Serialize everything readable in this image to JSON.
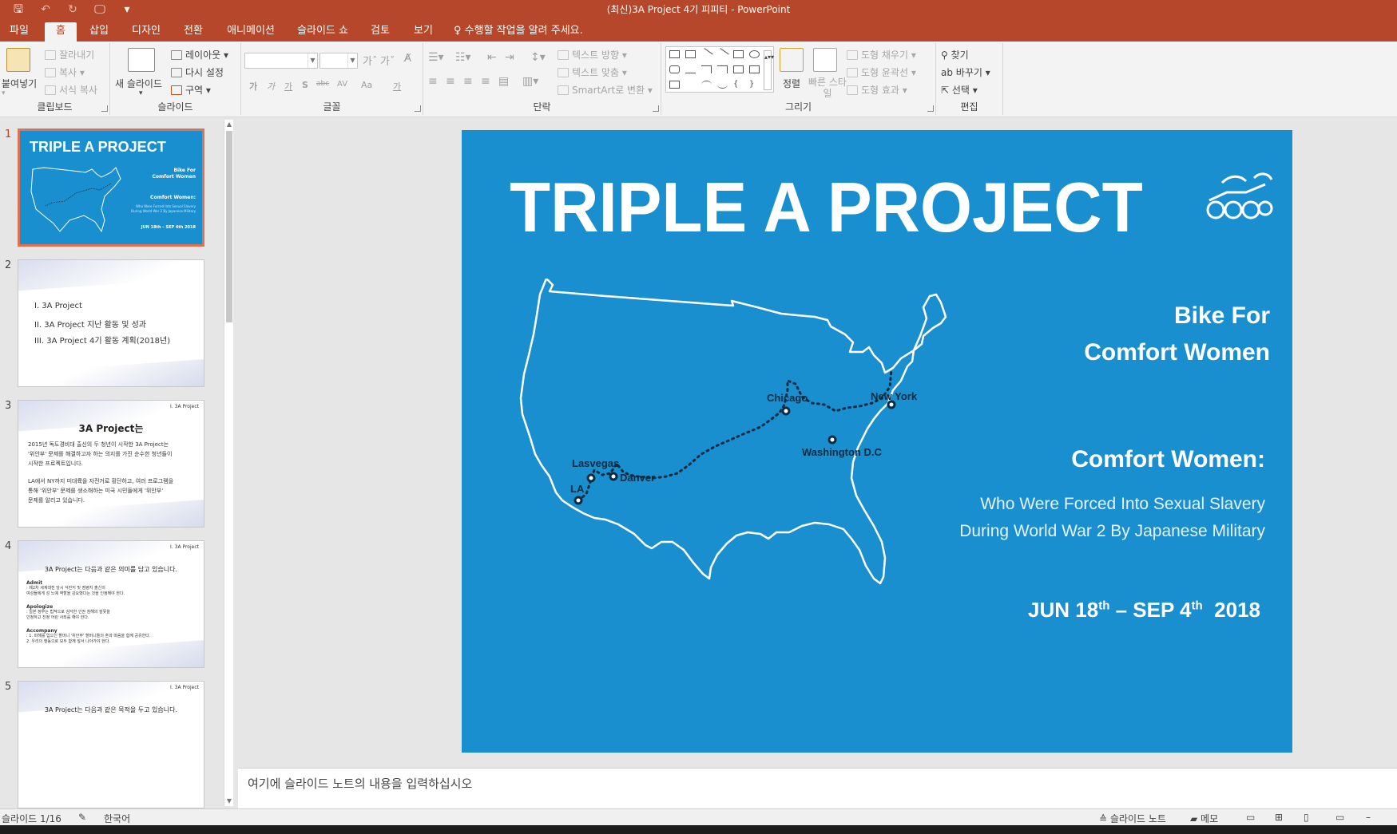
{
  "titlebar": {
    "title": "(최신)3A Project 4기 피피티 - PowerPoint",
    "qat": {
      "save": "🖫",
      "undo": "↶",
      "redo": "↻",
      "present": "🖵",
      "customize": "▾"
    }
  },
  "tabs": [
    "파일",
    "홈",
    "삽입",
    "디자인",
    "전환",
    "애니메이션",
    "슬라이드 쇼",
    "검토",
    "보기"
  ],
  "active_tab": "홈",
  "tell_me": "수행할 작업을 알려 주세요.",
  "ribbon": {
    "clipboard": {
      "paste": "붙여넣기",
      "cut": "잘라내기",
      "copy": "복사",
      "format_painter": "서식 복사",
      "label": "클립보드"
    },
    "slides": {
      "new_slide": "새 슬라이드",
      "layout": "레이아웃",
      "reset": "다시 설정",
      "section": "구역",
      "label": "슬라이드"
    },
    "font": {
      "label": "글꼴",
      "bold": "가",
      "italic": "가",
      "underline": "가",
      "shadow": "S",
      "strike": "abc",
      "spacing": "AV",
      "case": "Aa",
      "color": "가"
    },
    "paragraph": {
      "text_direction": "텍스트 방향",
      "align_text": "텍스트 맞춤",
      "smartart": "SmartArt로 변환",
      "label": "단락"
    },
    "drawing": {
      "arrange": "정렬",
      "quick_styles": "빠른 스타일",
      "shape_fill": "도형 채우기",
      "shape_outline": "도형 윤곽선",
      "shape_effects": "도형 효과",
      "label": "그리기"
    },
    "editing": {
      "find": "찾기",
      "replace": "바꾸기",
      "select": "선택",
      "label": "편집"
    }
  },
  "thumbnails": [
    {
      "num": "1",
      "title": "TRIPLE A PROJECT",
      "r1": "Bike For",
      "r2": "Comfort Women",
      "r3": "Comfort Women:",
      "r4": "Who Were Forced Into Sexual Slavery",
      "r5": "During World War 2 By Japanese Military",
      "r6": "JUN 18th – SEP 4th  2018"
    },
    {
      "num": "2",
      "items": [
        "I.   3A Project",
        "II.  3A Project 지난 활동 및 성과",
        "III. 3A Project 4기 활동 계획(2018년)"
      ]
    },
    {
      "num": "3",
      "tag": "I.  3A Project",
      "title": "3A Project는",
      "p1": "2015년 독도경비대 출신의 두 청년이 시작한 3A Project는",
      "p2": "'위안부' 문제를 해결하고자 하는 의지를 가진 순수한 청년들이",
      "p3": "시작한 프로젝트입니다.",
      "p4": "LA에서 NY까지 미대륙을 자전거로 횡단하고, 여러 프로그램을",
      "p5": "통해 '위안부' 문제를 생소해하는 미국 시민들에게 '위안부'",
      "p6": "문제를 알리고 있습니다."
    },
    {
      "num": "4",
      "tag": "I.  3A Project",
      "title": "3A Project는 다음과 같은 의미를 담고 있습니다.",
      "a1": "Admit",
      "a1t": ": 제2차 세계대전 당시 식민지 및 점령지 출신의",
      "a1t2": "  여성들에게 성 노예 역할을 강요했다는 것을 인정해야 한다.",
      "a2": "Apologize",
      "a2t": ": 일본 정부는 법적으로 심각한 인권 침해의 잘못을",
      "a2t2": "  인정하고 진정 어린 사죄를 해야 한다.",
      "a3": "Accompany",
      "a3t": ": 1. 피해를 입으신 할머니 '위안부' 할머니들의 혼과 마음을 함께 공유한다.",
      "a3t2": "  2. 우리의 행동으로 모두 함께 앞서 나아가야 한다."
    },
    {
      "num": "5",
      "tag": "I.  3A Project",
      "title": "3A Project는 다음과 같은 목적을 두고 있습니다."
    }
  ],
  "slide": {
    "title": "TRIPLE A PROJECT",
    "bike_line1": "Bike For",
    "bike_line2": "Comfort Women",
    "cw_heading": "Comfort Women:",
    "sub_line1": "Who Were Forced Into Sexual Slavery",
    "sub_line2": "During World War 2 By Japanese Military",
    "date_jun": "JUN 18",
    "date_th1": "th",
    "date_mid": " – SEP 4",
    "date_th2": "th",
    "date_year": "2018",
    "cities": {
      "la": "LA",
      "lasvegas": "Lasvegas",
      "denver": "Danver",
      "chicago": "Chicago",
      "dc": "Washington D.C",
      "ny": "New York"
    },
    "bg_color": "#1a8fd0"
  },
  "notes_placeholder": "여기에 슬라이드 노트의 내용을 입력하십시오",
  "status": {
    "slide_counter": "슬라이드 1/16",
    "language": "한국어",
    "notes_btn": "슬라이드 노트",
    "comments_btn": "메모"
  },
  "colors": {
    "accent": "#b7472a",
    "slide_bg": "#1a8fd0"
  }
}
